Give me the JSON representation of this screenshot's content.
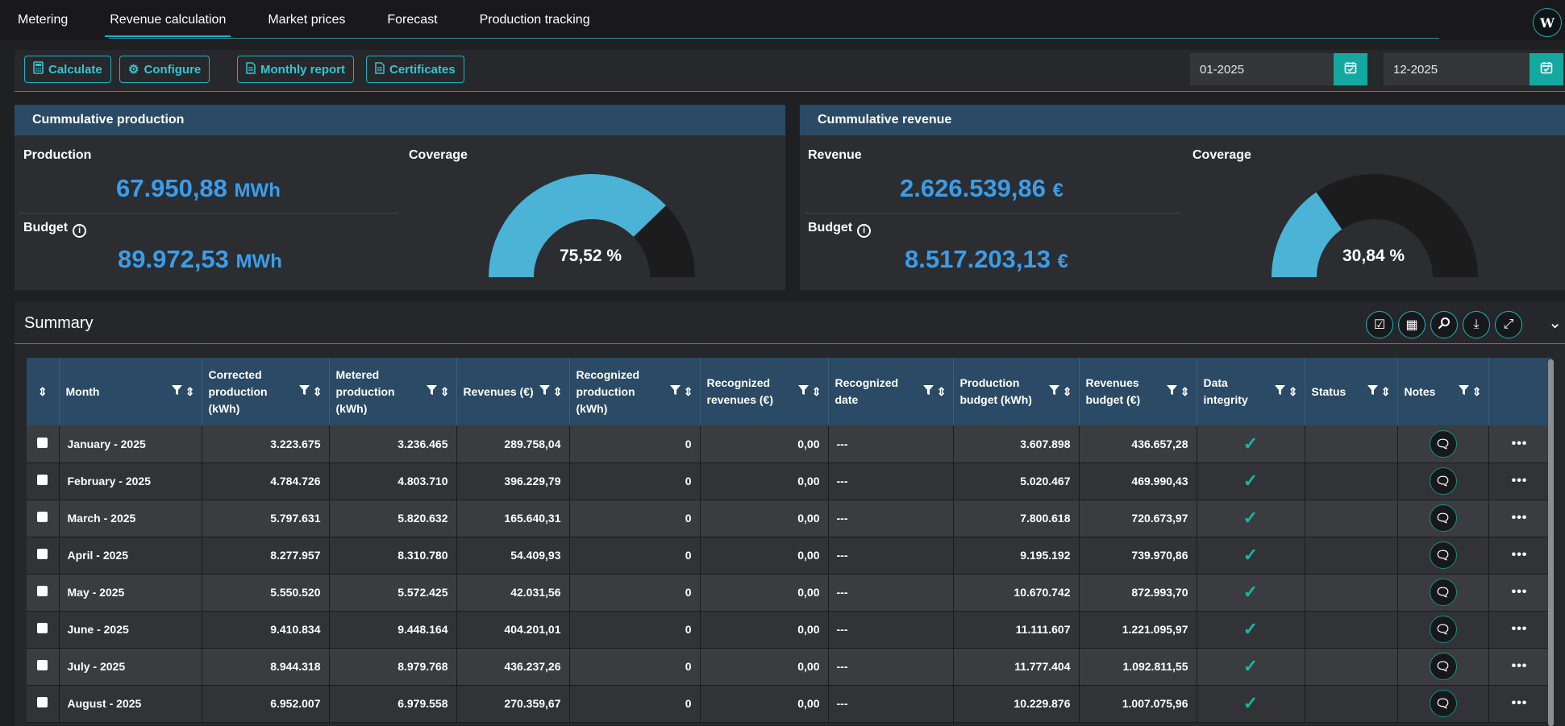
{
  "nav": {
    "tabs": [
      {
        "label": "Metering"
      },
      {
        "label": "Revenue calculation"
      },
      {
        "label": "Market prices"
      },
      {
        "label": "Forecast"
      },
      {
        "label": "Production tracking"
      }
    ],
    "active_tab": "Revenue calculation",
    "logo_letter": "W"
  },
  "toolbar": {
    "calculate": "Calculate",
    "configure": "Configure",
    "monthly_report": "Monthly report",
    "certificates": "Certificates",
    "date_from": "01-2025",
    "date_to": "12-2025"
  },
  "production_card": {
    "title": "Cummulative production",
    "production_label": "Production",
    "production_value": "67.950,88",
    "production_unit": "MWh",
    "budget_label": "Budget",
    "budget_value": "89.972,53",
    "budget_unit": "MWh",
    "coverage_label": "Coverage",
    "coverage_text": "75,52 %",
    "coverage_fraction": 0.7552
  },
  "revenue_card": {
    "title": "Cummulative revenue",
    "revenue_label": "Revenue",
    "revenue_value": "2.626.539,86",
    "revenue_unit": "€",
    "budget_label": "Budget",
    "budget_value": "8.517.203,13",
    "budget_unit": "€",
    "coverage_label": "Coverage",
    "coverage_text": "30,84 %",
    "coverage_fraction": 0.3084
  },
  "summary": {
    "title": "Summary",
    "columns": [
      "Month",
      "Corrected production (kWh)",
      "Metered production (kWh)",
      "Revenues (€)",
      "Recognized production (kWh)",
      "Recognized revenues (€)",
      "Recognized date",
      "Production budget (kWh)",
      "Revenues budget (€)",
      "Data integrity",
      "Status",
      "Notes"
    ],
    "rows": [
      {
        "month": "January - 2025",
        "corrected": "3.223.675",
        "metered": "3.236.465",
        "revenues": "289.758,04",
        "rec_prod": "0",
        "rec_rev": "0,00",
        "rec_date": "---",
        "prod_budget": "3.607.898",
        "rev_budget": "436.657,28"
      },
      {
        "month": "February - 2025",
        "corrected": "4.784.726",
        "metered": "4.803.710",
        "revenues": "396.229,79",
        "rec_prod": "0",
        "rec_rev": "0,00",
        "rec_date": "---",
        "prod_budget": "5.020.467",
        "rev_budget": "469.990,43"
      },
      {
        "month": "March - 2025",
        "corrected": "5.797.631",
        "metered": "5.820.632",
        "revenues": "165.640,31",
        "rec_prod": "0",
        "rec_rev": "0,00",
        "rec_date": "---",
        "prod_budget": "7.800.618",
        "rev_budget": "720.673,97"
      },
      {
        "month": "April - 2025",
        "corrected": "8.277.957",
        "metered": "8.310.780",
        "revenues": "54.409,93",
        "rec_prod": "0",
        "rec_rev": "0,00",
        "rec_date": "---",
        "prod_budget": "9.195.192",
        "rev_budget": "739.970,86"
      },
      {
        "month": "May - 2025",
        "corrected": "5.550.520",
        "metered": "5.572.425",
        "revenues": "42.031,56",
        "rec_prod": "0",
        "rec_rev": "0,00",
        "rec_date": "---",
        "prod_budget": "10.670.742",
        "rev_budget": "872.993,70"
      },
      {
        "month": "June - 2025",
        "corrected": "9.410.834",
        "metered": "9.448.164",
        "revenues": "404.201,01",
        "rec_prod": "0",
        "rec_rev": "0,00",
        "rec_date": "---",
        "prod_budget": "11.111.607",
        "rev_budget": "1.221.095,97"
      },
      {
        "month": "July - 2025",
        "corrected": "8.944.318",
        "metered": "8.979.768",
        "revenues": "436.237,26",
        "rec_prod": "0",
        "rec_rev": "0,00",
        "rec_date": "---",
        "prod_budget": "11.777.404",
        "rev_budget": "1.092.811,55"
      },
      {
        "month": "August - 2025",
        "corrected": "6.952.007",
        "metered": "6.979.558",
        "revenues": "270.359,67",
        "rec_prod": "0",
        "rec_rev": "0,00",
        "rec_date": "---",
        "prod_budget": "10.229.876",
        "rev_budget": "1.007.075,96"
      }
    ]
  },
  "colors": {
    "accent": "#1fb3c2",
    "gauge_fill": "#4ab3d6",
    "gauge_track": "#1c1c1d",
    "value_blue": "#3b9dea",
    "check_green": "#16b9a6",
    "header_blue": "#2a4a65"
  },
  "icons": {
    "calculate": "calculator-icon",
    "configure": "gears-icon",
    "monthly_report": "document-icon",
    "certificates": "document-icon",
    "calendar": "calendar-check-icon",
    "info": "info-icon",
    "filter": "filter-icon",
    "sort": "sort-icon",
    "notes": "chat-icon",
    "more": "more-icon"
  }
}
